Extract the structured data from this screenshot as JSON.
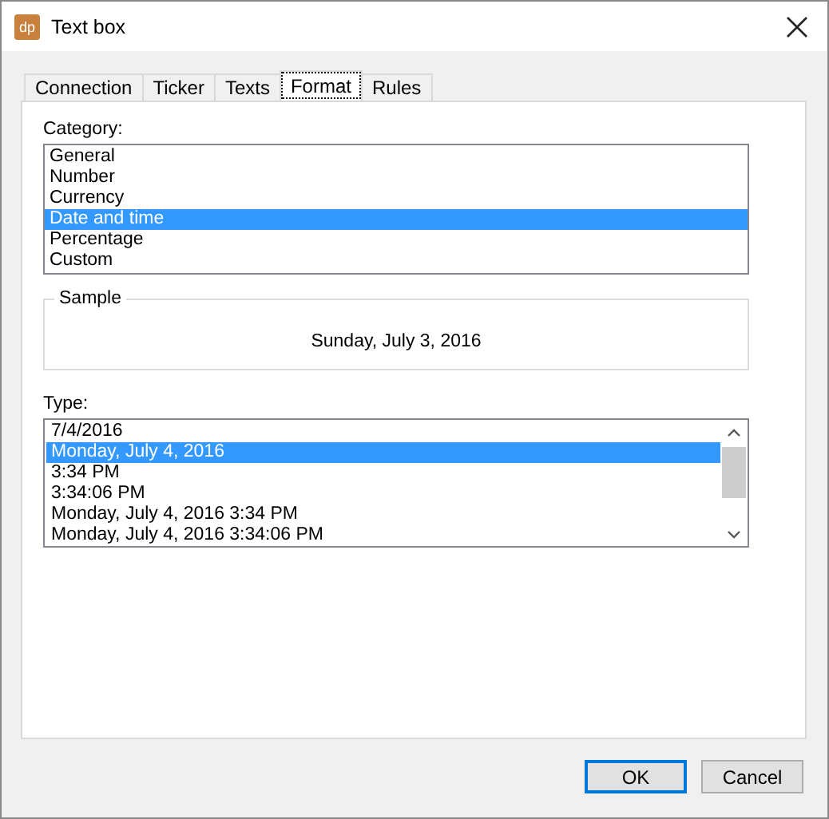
{
  "window": {
    "title": "Text box",
    "app_icon": "dp"
  },
  "tabs": [
    {
      "label": "Connection",
      "selected": false
    },
    {
      "label": "Ticker",
      "selected": false
    },
    {
      "label": "Texts",
      "selected": false
    },
    {
      "label": "Format",
      "selected": true
    },
    {
      "label": "Rules",
      "selected": false
    }
  ],
  "category": {
    "label": "Category:",
    "items": [
      {
        "label": "General",
        "selected": false
      },
      {
        "label": "Number",
        "selected": false
      },
      {
        "label": "Currency",
        "selected": false
      },
      {
        "label": "Date and time",
        "selected": true
      },
      {
        "label": "Percentage",
        "selected": false
      },
      {
        "label": "Custom",
        "selected": false
      }
    ]
  },
  "sample": {
    "legend": "Sample",
    "value": "Sunday, July 3, 2016"
  },
  "type": {
    "label": "Type:",
    "items": [
      {
        "label": "7/4/2016",
        "selected": false
      },
      {
        "label": "Monday, July 4, 2016",
        "selected": true
      },
      {
        "label": "3:34 PM",
        "selected": false
      },
      {
        "label": "3:34:06 PM",
        "selected": false
      },
      {
        "label": "Monday, July 4, 2016 3:34 PM",
        "selected": false
      },
      {
        "label": "Monday, July 4, 2016 3:34:06 PM",
        "selected": false
      }
    ]
  },
  "buttons": [
    {
      "label": "OK",
      "default": true
    },
    {
      "label": "Cancel",
      "default": false
    }
  ]
}
